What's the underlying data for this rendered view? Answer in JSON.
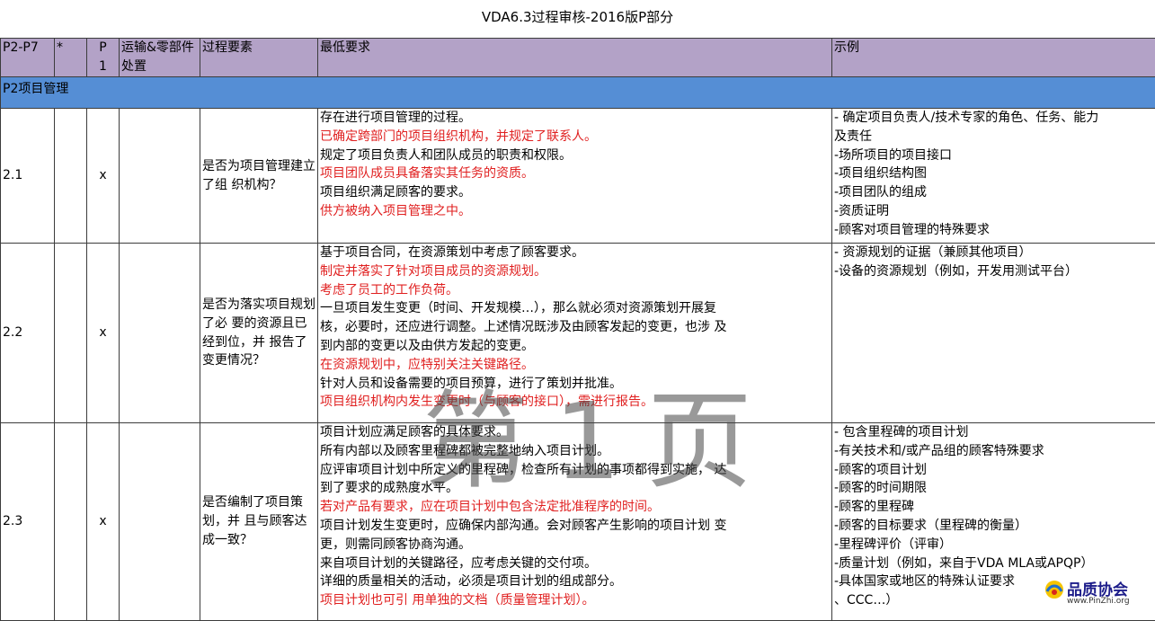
{
  "title": "VDA6.3过程审核-2016版P部分",
  "headers": {
    "p_range": "P2-P7",
    "star": "*",
    "p1": "P\n1",
    "transport": "运输&零部件处置",
    "element": "过程要素",
    "min_req": "最低要求",
    "example": "示例"
  },
  "section": "P2项目管理",
  "rows": [
    {
      "id": "2.1",
      "p1": "x",
      "question": "是否为项目管理建立了组 织机构？",
      "requirements": [
        {
          "text": "存在进行项目管理的过程。",
          "red": false
        },
        {
          "text": "已确定跨部门的项目组织机构，并规定了联系人。",
          "red": true
        },
        {
          "text": "规定了项目负责人和团队成员的职责和权限。",
          "red": false
        },
        {
          "text": "项目团队成员具备落实其任务的资质。",
          "red": true
        },
        {
          "text": "项目组织满足顾客的要求。",
          "red": false
        },
        {
          "text": "供方被纳入项目管理之中。",
          "red": true
        }
      ],
      "examples": [
        "- 确定项目负责人/技术专家的角色、任务、能力",
        "及责任",
        "-场所项目的项目接口",
        "-项目组织结构图",
        "-项目团队的组成",
        "-资质证明",
        "-顾客对项目管理的特殊要求"
      ]
    },
    {
      "id": "2.2",
      "p1": "x",
      "question": "是否为落实项目规划了必 要的资源且已经到位，并 报告了变更情况？",
      "requirements": [
        {
          "text": "基于项目合同，在资源策划中考虑了顾客要求。",
          "red": false
        },
        {
          "text": "制定并落实了针对项目成员的资源规划。",
          "red": true
        },
        {
          "text": "考虑了员工的工作负荷。",
          "red": true
        },
        {
          "text": "一旦项目发生变更（时间、开发规模…），那么就必须对资源策划开展复",
          "red": false
        },
        {
          "text": "核，必要时，还应进行调整。上述情况既涉及由顾客发起的变更，也涉 及",
          "red": false
        },
        {
          "text": "到内部的变更以及由供方发起的变更。",
          "red": false
        },
        {
          "text": "在资源规划中，应特别关注关键路径。",
          "red": true
        },
        {
          "text": "针对人员和设备需要的项目预算，进行了策划并批准。",
          "red": false
        },
        {
          "text": "项目组织机构内发生变更时（与顾客的接口），需进行报告。",
          "red": true
        }
      ],
      "examples": [
        "- 资源规划的证据（兼顾其他项目）",
        "-设备的资源规划（例如，开发用测试平台）"
      ]
    },
    {
      "id": "2.3",
      "p1": "x",
      "question": "是否编制了项目策划，并 且与顾客达成一致？",
      "requirements": [
        {
          "text": "项目计划应满足顾客的具体要求。",
          "red": false
        },
        {
          "text": "所有内部以及顾客里程碑都被完整地纳入项目计划。",
          "red": false
        },
        {
          "text": "应评审项目计划中所定义的里程碑，检查所有计划的事项都得到实施，  达",
          "red": false
        },
        {
          "text": "到了要求的成熟度水平。",
          "red": false
        },
        {
          "text": "若对产品有要求，应在项目计划中包含法定批准程序的时间。",
          "red": true
        },
        {
          "text": "项目计划发生变更时，应确保内部沟通。会对顾客产生影响的项目计划 变",
          "red": false
        },
        {
          "text": "更，则需同顾客协商沟通。",
          "red": false
        },
        {
          "text": "来自项目计划的关键路径，应考虑关键的交付项。",
          "red": false
        },
        {
          "text": "详细的质量相关的活动，必须是项目计划的组成部分。",
          "red": false
        },
        {
          "text": "项目计划也可引 用单独的文档（质量管理计划）。",
          "red": true
        }
      ],
      "examples": [
        "- 包含里程碑的项目计划",
        "-有关技术和/或产品组的顾客特殊要求",
        "-顾客的项目计划",
        "-顾客的时间期限",
        "-顾客的里程碑",
        "-顾客的目标要求（里程碑的衡量）",
        "-里程碑评价（评审）",
        "-质量计划（例如，来自于VDA MLA或APQP）",
        "-具体国家或地区的特殊认证要求",
        "、CCC…）"
      ]
    }
  ],
  "watermark": "第1页",
  "logo": {
    "name": "品质协会",
    "url": "www.PinZhi.org",
    "icon": "pinzhi-logo-icon"
  }
}
